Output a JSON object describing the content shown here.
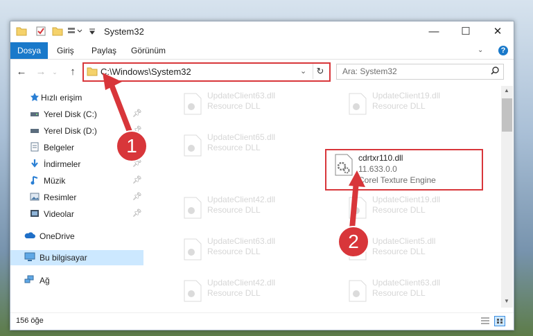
{
  "window": {
    "title": "System32",
    "controls": {
      "minimize": "—",
      "maximize": "☐",
      "close": "✕"
    }
  },
  "ribbon": {
    "tabs": [
      "Dosya",
      "Giriş",
      "Paylaş",
      "Görünüm"
    ],
    "help": "?"
  },
  "navigation": {
    "address": "C:\\Windows\\System32",
    "search_placeholder": "Ara: System32"
  },
  "sidebar": {
    "items": [
      {
        "label": "Hızlı erişim",
        "icon": "star-icon"
      },
      {
        "label": "Yerel Disk (C:)",
        "icon": "drive-icon"
      },
      {
        "label": "Yerel Disk (D:)",
        "icon": "drive-icon"
      },
      {
        "label": "Belgeler",
        "icon": "documents-icon"
      },
      {
        "label": "İndirmeler",
        "icon": "download-icon"
      },
      {
        "label": "Müzik",
        "icon": "music-icon"
      },
      {
        "label": "Resimler",
        "icon": "pictures-icon"
      },
      {
        "label": "Videolar",
        "icon": "videos-icon"
      },
      {
        "label": "OneDrive",
        "icon": "cloud-icon"
      },
      {
        "label": "Bu bilgisayar",
        "icon": "computer-icon"
      },
      {
        "label": "Ağ",
        "icon": "network-icon"
      }
    ]
  },
  "files": [
    {
      "name": "UpdateClient63.dll",
      "type": "Resource DLL"
    },
    {
      "name": "UpdateClient19.dll",
      "type": "Resource DLL"
    },
    {
      "name": "UpdateClient65.dll",
      "type": "Resource DLL"
    },
    {
      "name": "cdrtxr110.dll",
      "version": "11.633.0.0",
      "description": "Corel Texture Engine"
    },
    {
      "name": "UpdateClient42.dll",
      "type": "Resource DLL"
    },
    {
      "name": "UpdateClient19.dll",
      "type": "Resource DLL"
    },
    {
      "name": "UpdateClient63.dll",
      "type": "Resource DLL"
    },
    {
      "name": "UpdateClient5.dll",
      "type": "Resource DLL"
    },
    {
      "name": "UpdateClient42.dll",
      "type": "Resource DLL"
    },
    {
      "name": "UpdateClient63.dll",
      "type": "Resource DLL"
    }
  ],
  "status": {
    "count": "156 öğe"
  },
  "annotations": {
    "step1": "1",
    "step2": "2"
  },
  "colors": {
    "accent": "#1979ca",
    "annotation": "#d8363a",
    "selection": "#cce8ff"
  }
}
